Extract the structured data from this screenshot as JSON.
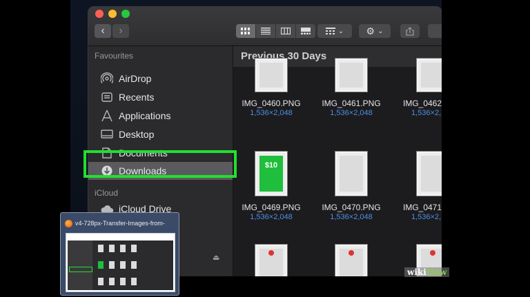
{
  "sidebar": {
    "favourites_header": "Favourites",
    "icloud_header": "iCloud",
    "items": [
      {
        "label": "AirDrop",
        "icon": "airdrop-icon"
      },
      {
        "label": "Recents",
        "icon": "clock-icon"
      },
      {
        "label": "Applications",
        "icon": "applications-icon"
      },
      {
        "label": "Desktop",
        "icon": "desktop-icon"
      },
      {
        "label": "Documents",
        "icon": "document-icon"
      },
      {
        "label": "Downloads",
        "icon": "download-icon",
        "selected": true
      }
    ],
    "icloud_items": [
      {
        "label": "iCloud Drive",
        "icon": "cloud-icon"
      }
    ]
  },
  "content": {
    "section_title": "Previous 30 Days",
    "files": [
      {
        "name": "IMG_0460.PNG",
        "dims": "1,536×2,048"
      },
      {
        "name": "IMG_0461.PNG",
        "dims": "1,536×2,048"
      },
      {
        "name": "IMG_0462",
        "dims": "1,536×2,"
      },
      {
        "name": "IMG_0469.PNG",
        "dims": "1,536×2,048",
        "amount": "$10"
      },
      {
        "name": "IMG_0470.PNG",
        "dims": "1,536×2,048"
      },
      {
        "name": "IMG_0471",
        "dims": "1,536×2,"
      }
    ]
  },
  "preview": {
    "title": "v4-728px-Transfer-Images-from-"
  },
  "watermark": {
    "wiki": "wiki",
    "how": "How"
  },
  "colors": {
    "highlight": "#22e02e",
    "file_dims": "#4f8ee8",
    "selected_row": "#5a5a5f"
  }
}
